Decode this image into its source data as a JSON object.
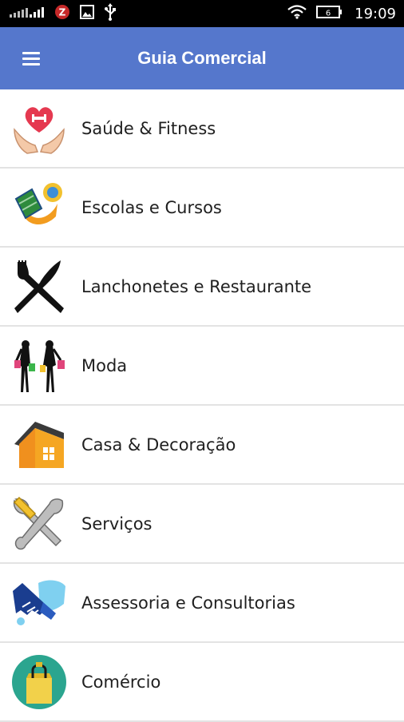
{
  "status_bar": {
    "time": "19:09",
    "icons": [
      "signal-icon",
      "notification-icon",
      "image-icon",
      "usb-icon",
      "wifi-icon",
      "battery-icon"
    ]
  },
  "app_bar": {
    "title": "Guia Comercial",
    "menu_icon": "hamburger-menu-icon",
    "color": "#5577cc"
  },
  "categories": [
    {
      "label": "Saúde & Fitness",
      "icon": "heart-hands-icon"
    },
    {
      "label": "Escolas e Cursos",
      "icon": "book-icon"
    },
    {
      "label": "Lanchonetes e Restaurante",
      "icon": "fork-knife-icon"
    },
    {
      "label": "Moda",
      "icon": "fashion-women-icon"
    },
    {
      "label": "Casa & Decoração",
      "icon": "house-icon"
    },
    {
      "label": "Serviços",
      "icon": "tools-icon"
    },
    {
      "label": "Assessoria e Consultorias",
      "icon": "handshake-icon"
    },
    {
      "label": "Comércio",
      "icon": "shopping-bag-icon"
    }
  ]
}
